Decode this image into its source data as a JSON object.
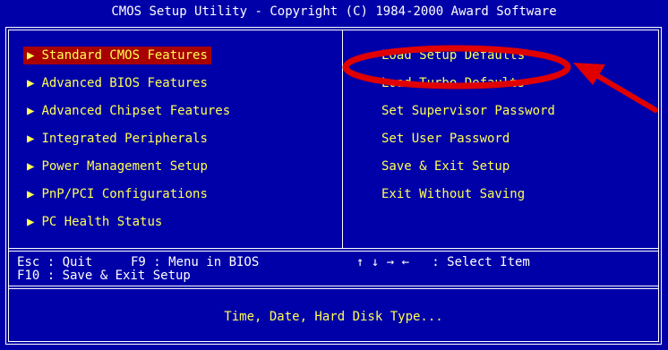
{
  "title": "CMOS Setup Utility - Copyright (C) 1984-2000 Award Software",
  "left_menu": [
    {
      "label": "Standard CMOS Features",
      "selected": true
    },
    {
      "label": "Advanced BIOS Features"
    },
    {
      "label": "Advanced Chipset Features"
    },
    {
      "label": "Integrated Peripherals"
    },
    {
      "label": "Power Management Setup"
    },
    {
      "label": "PnP/PCI Configurations"
    },
    {
      "label": "PC Health Status"
    }
  ],
  "right_menu": [
    {
      "label": "Load Setup Defaults"
    },
    {
      "label": "Load Turbo Defaults"
    },
    {
      "label": "Set Supervisor Password"
    },
    {
      "label": "Set User Password"
    },
    {
      "label": "Save & Exit Setup"
    },
    {
      "label": "Exit Without Saving"
    }
  ],
  "help": {
    "line1_left": "Esc : Quit",
    "line1_mid": "F9 : Menu in BIOS",
    "line1_right": "↑ ↓ → ←   : Select Item",
    "line2": "F10 : Save & Exit Setup"
  },
  "status_text": "Time, Date, Hard Disk Type...",
  "colors": {
    "background": "#0000a8",
    "menu_text": "#ffff54",
    "selected_bg": "#a80000",
    "annotation": "#e00000"
  },
  "icons": {
    "menu_marker": "triangle-right-icon"
  }
}
